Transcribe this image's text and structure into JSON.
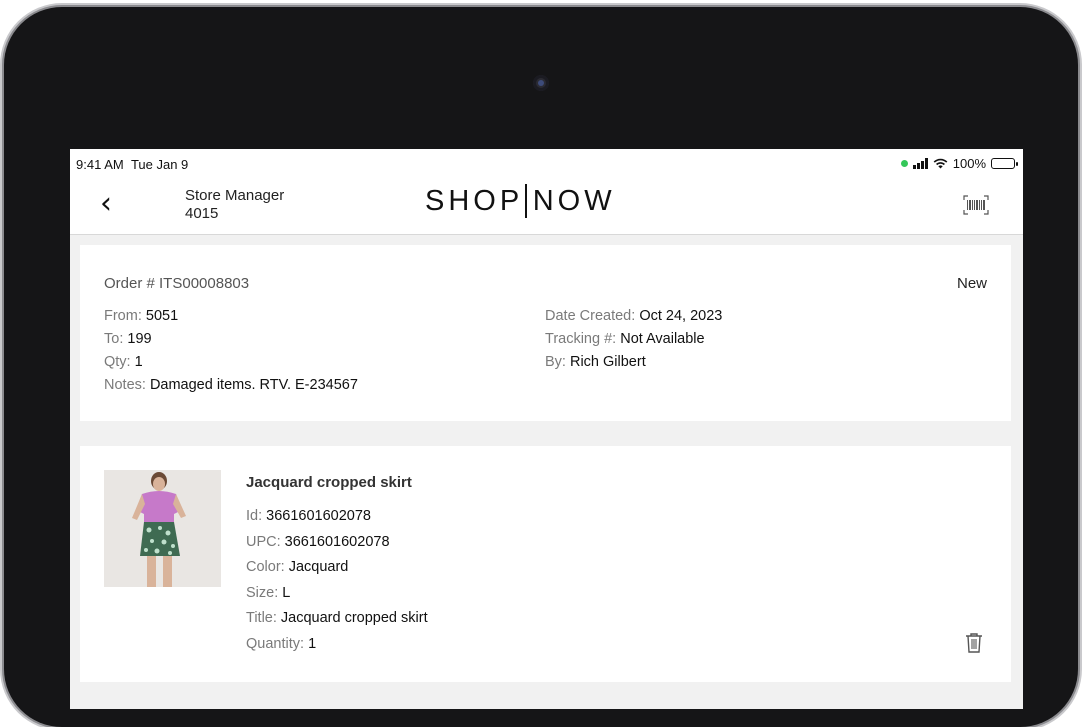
{
  "status_bar": {
    "time": "9:41 AM",
    "date": "Tue Jan 9",
    "battery": "100%"
  },
  "header": {
    "role": "Store Manager",
    "store_id": "4015",
    "logo_left": "SHOP",
    "logo_right": "NOW"
  },
  "order": {
    "number_label": "Order # ITS00008803",
    "status": "New",
    "left_fields": [
      {
        "label": "From: ",
        "value": "5051"
      },
      {
        "label": "To: ",
        "value": "199"
      },
      {
        "label": "Qty: ",
        "value": "1"
      },
      {
        "label": "Notes: ",
        "value": "Damaged items. RTV. E-234567"
      }
    ],
    "right_fields": [
      {
        "label": "Date Created: ",
        "value": "Oct 24, 2023"
      },
      {
        "label": "Tracking #: ",
        "value": "Not Available"
      },
      {
        "label": "By: ",
        "value": "Rich Gilbert"
      }
    ]
  },
  "item": {
    "name": "Jacquard cropped skirt",
    "fields": [
      {
        "label": "Id: ",
        "value": "3661601602078"
      },
      {
        "label": "UPC: ",
        "value": "3661601602078"
      },
      {
        "label": "Color: ",
        "value": "Jacquard"
      },
      {
        "label": "Size: ",
        "value": "L"
      },
      {
        "label": "Title: ",
        "value": "Jacquard cropped skirt"
      },
      {
        "label": "Quantity: ",
        "value": "1"
      }
    ]
  },
  "icons": {
    "back": "chevron-left-icon",
    "barcode": "barcode-scan-icon",
    "trash": "trash-icon"
  }
}
